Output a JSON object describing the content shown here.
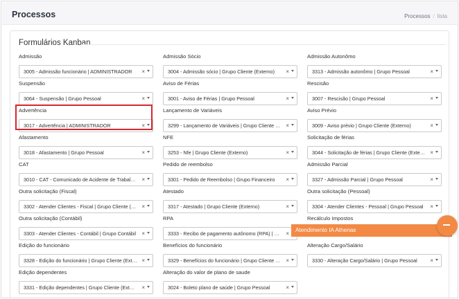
{
  "header": {
    "title": "Processos",
    "breadcrumb": [
      "Processos",
      "lista"
    ]
  },
  "card": {
    "title": "Formulários Kanban"
  },
  "fields": [
    {
      "label": "Admissão",
      "value": "3005 - Admissão funcionário | ADMINISTRADOR"
    },
    {
      "label": "Admissão Sócio",
      "value": "3004 - Admissão sócio | Grupo Cliente (Externo)"
    },
    {
      "label": "Admissão Autonômo",
      "value": "3313 - Admissão autonômo | Grupo Pessoal"
    },
    {
      "label": "Suspensão",
      "value": "3064 - Suspensão | Grupo Pessoal"
    },
    {
      "label": "Aviso de Férias",
      "value": "3001 - Aviso de Férias | Grupo Pessoal"
    },
    {
      "label": "Rescisão",
      "value": "3007 - Rescisão | Grupo Pessoal"
    },
    {
      "label": "Advertência",
      "value": "3017 - Advertência | ADMINISTRADOR"
    },
    {
      "label": "Lançamento de Variáveis",
      "value": "3299 - Lançamento de Variáveis | Grupo Cliente (Ex..."
    },
    {
      "label": "Aviso Prévio",
      "value": "3009 - Aviso prévio | Grupo Cliente (Externo)"
    },
    {
      "label": "Afastamento",
      "value": "3018 - Afastamento | Grupo Pessoal"
    },
    {
      "label": "NFE",
      "value": "3253 - Nfe | Grupo Cliente (Externo)"
    },
    {
      "label": "Solicitação de férias",
      "value": "3044 - Solicitação de férias | Grupo Cliente (Externo)"
    },
    {
      "label": "CAT",
      "value": "3010 - CAT - Comunicado de Acidente de Trabalho (..."
    },
    {
      "label": "Pedido de reembolso",
      "value": "3301 - Pedido de Reembolso | Grupo Financeiro"
    },
    {
      "label": "Admissão Parcial",
      "value": "3327 - Admissão Parcial | Grupo Pessoal"
    },
    {
      "label": "Outra solicitação (Fiscal)",
      "value": "3302 - Atender Clientes - Fiscal | Grupo Cliente (Ext..."
    },
    {
      "label": "Atestado",
      "value": "3317 - Atestado | Grupo Cliente (Externo)"
    },
    {
      "label": "Outra solicitação (Pessoal)",
      "value": "3304 - Atender Clientes - Pessoal | Grupo Pessoal"
    },
    {
      "label": "Outra solicitação (Contábil)",
      "value": "3303 - Atender Clientes - Contábil | Grupo Contábil"
    },
    {
      "label": "RPA",
      "value": "3333 - Recibo de pagamento autônomo (RPA) | USU..."
    },
    {
      "label": "Recálculo Impostos",
      "value": ""
    },
    {
      "label": "Edição do funcionário",
      "value": "3328 - Edição do funcionário | Grupo Cliente (Exter..."
    },
    {
      "label": "Benefícios do funcionário",
      "value": "3329 - Benefícios do funcionário | Grupo Cliente (Ex..."
    },
    {
      "label": "Alteração Cargo/Salário",
      "value": "3330 - Alteração Cargo/Salário | Grupo Pessoal"
    },
    {
      "label": "Edição dependentes",
      "value": "3331 - Edição dependentes | Grupo Cliente (Externo)"
    },
    {
      "label": "Alteração do valor de plano de saude",
      "value": "3024 - Boleto plano de saúde | Grupo Pessoal"
    }
  ],
  "chat": {
    "label": "Atendimento IA Athenas",
    "color": "#f28a45"
  },
  "highlight_color": "#d7262c"
}
